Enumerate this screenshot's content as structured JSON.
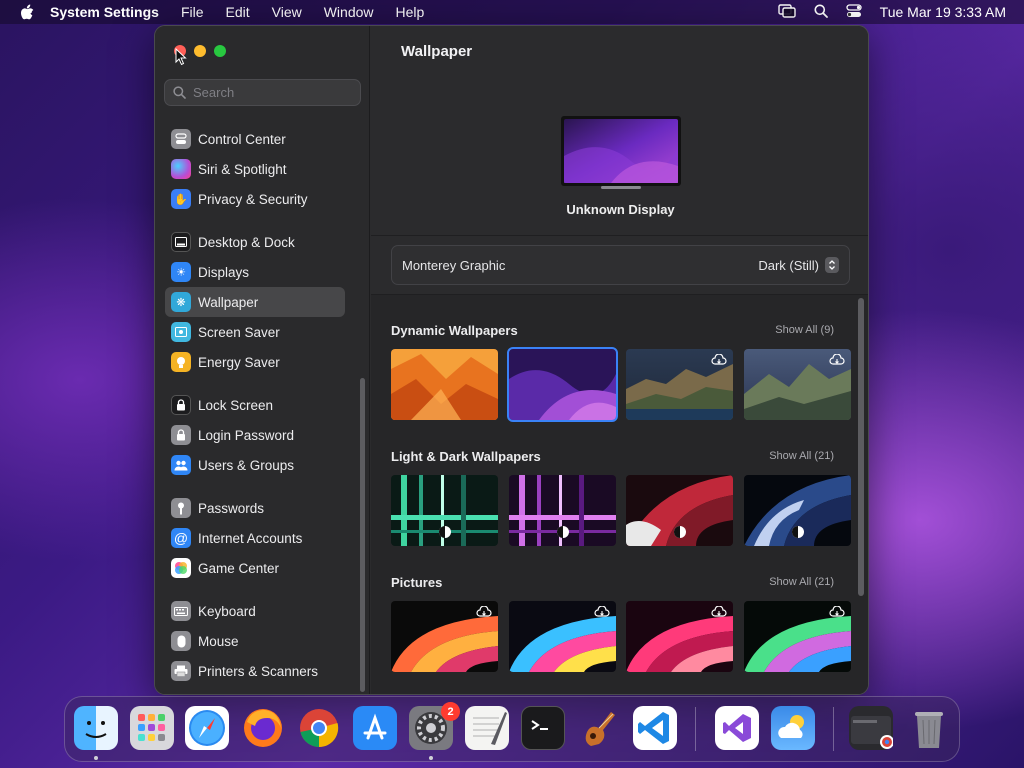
{
  "menubar": {
    "app_name": "System Settings",
    "menus": [
      "File",
      "Edit",
      "View",
      "Window",
      "Help"
    ],
    "clock": "Tue Mar 19  3:33 AM"
  },
  "window": {
    "search": {
      "placeholder": "Search",
      "value": ""
    },
    "sidebar": {
      "items": [
        {
          "label": "Control Center",
          "icon": "control-center-icon",
          "color": "#8e8e93"
        },
        {
          "label": "Siri & Spotlight",
          "icon": "siri-icon",
          "color": "#b44fd6"
        },
        {
          "label": "Privacy & Security",
          "icon": "hand-icon",
          "color": "#3a7ef6"
        },
        {
          "label": "Desktop & Dock",
          "icon": "dock-icon",
          "color": "#1c1c1e"
        },
        {
          "label": "Displays",
          "icon": "sun-icon",
          "color": "#2f86f6"
        },
        {
          "label": "Wallpaper",
          "icon": "wallpaper-icon",
          "color": "#31a8d9"
        },
        {
          "label": "Screen Saver",
          "icon": "screen-saver-icon",
          "color": "#41b8e0"
        },
        {
          "label": "Energy Saver",
          "icon": "bulb-icon",
          "color": "#f5b324"
        },
        {
          "label": "Lock Screen",
          "icon": "lock-icon",
          "color": "#1c1c1e"
        },
        {
          "label": "Login Password",
          "icon": "lock-icon",
          "color": "#8e8e93"
        },
        {
          "label": "Users & Groups",
          "icon": "users-icon",
          "color": "#2f86f6"
        },
        {
          "label": "Passwords",
          "icon": "key-icon",
          "color": "#8e8e93"
        },
        {
          "label": "Internet Accounts",
          "icon": "at-icon",
          "color": "#2f86f6"
        },
        {
          "label": "Game Center",
          "icon": "game-center-icon",
          "color": "#ffffff"
        },
        {
          "label": "Keyboard",
          "icon": "keyboard-icon",
          "color": "#8e8e93"
        },
        {
          "label": "Mouse",
          "icon": "mouse-icon",
          "color": "#8e8e93"
        },
        {
          "label": "Printers & Scanners",
          "icon": "printer-icon",
          "color": "#8e8e93"
        }
      ],
      "active": "Wallpaper"
    },
    "main": {
      "title": "Wallpaper",
      "display_name": "Unknown Display",
      "wallpaper_name": "Monterey Graphic",
      "wallpaper_style": "Dark (Still)",
      "sections": [
        {
          "title": "Dynamic Wallpapers",
          "show_all": "Show All (9)"
        },
        {
          "title": "Light & Dark Wallpapers",
          "show_all": "Show All (21)"
        },
        {
          "title": "Pictures",
          "show_all": "Show All (21)"
        }
      ]
    }
  },
  "dock": {
    "apps": [
      "Finder",
      "Launchpad",
      "Safari",
      "Firefox",
      "Chrome",
      "App Store",
      "System Settings",
      "TextEdit",
      "Terminal",
      "GarageBand",
      "Visual Studio Code",
      "Visual Studio",
      "Weather",
      "Downloads",
      "Trash"
    ],
    "settings_badge": "2"
  },
  "colors": {
    "accent": "#3a82f7",
    "window_bg": "#2b2b2d",
    "sidebar_bg": "#2a2a2c"
  }
}
